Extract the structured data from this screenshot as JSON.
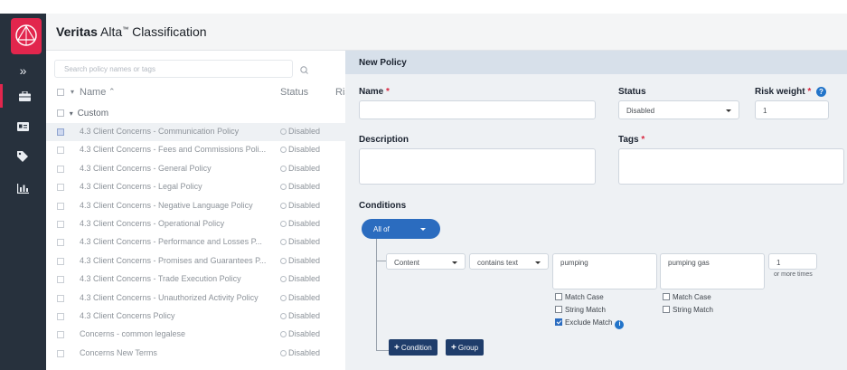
{
  "app": {
    "brand_bold": "Veritas",
    "brand_mid": " Alta",
    "brand_tm": "™",
    "brand_tail": " Classification"
  },
  "rail": {
    "expand_glyph": "»"
  },
  "search": {
    "placeholder": "Search policy names or tags"
  },
  "list": {
    "headers": {
      "name": "Name",
      "status": "Status",
      "risk": "Ris"
    },
    "group_label": "Custom",
    "rows": [
      {
        "name": "4.3 Client Concerns - Communication Policy",
        "status": "Disabled",
        "selected": true
      },
      {
        "name": "4.3 Client Concerns - Fees and Commissions Poli...",
        "status": "Disabled"
      },
      {
        "name": "4.3 Client Concerns - General Policy",
        "status": "Disabled"
      },
      {
        "name": "4.3 Client Concerns - Legal Policy",
        "status": "Disabled"
      },
      {
        "name": "4.3 Client Concerns - Negative Language Policy",
        "status": "Disabled"
      },
      {
        "name": "4.3 Client Concerns - Operational Policy",
        "status": "Disabled"
      },
      {
        "name": "4.3 Client Concerns - Performance and Losses P...",
        "status": "Disabled"
      },
      {
        "name": "4.3 Client Concerns - Promises and Guarantees P...",
        "status": "Disabled"
      },
      {
        "name": "4.3 Client Concerns - Trade Execution Policy",
        "status": "Disabled"
      },
      {
        "name": "4.3 Client Concerns - Unauthorized Activity Policy",
        "status": "Disabled"
      },
      {
        "name": "4.3 Client Concerns Policy",
        "status": "Disabled"
      },
      {
        "name": "Concerns - common legalese",
        "status": "Disabled"
      },
      {
        "name": "Concerns New Terms",
        "status": "Disabled"
      }
    ]
  },
  "form": {
    "title": "New Policy",
    "name_label": "Name",
    "status_label": "Status",
    "status_value": "Disabled",
    "risk_label": "Risk weight",
    "risk_value": "1",
    "description_label": "Description",
    "tags_label": "Tags",
    "required_mark": "*",
    "help_glyph": "?"
  },
  "conditions": {
    "label": "Conditions",
    "operator": "All of",
    "field": "Content",
    "op": "contains text",
    "value1": "pumping",
    "value2": "pumping gas",
    "count": "1",
    "count_suffix": "or more times",
    "match_case": "Match Case",
    "string_match": "String Match",
    "exclude_match": "Exclude Match",
    "info_glyph": "i",
    "add_condition": "Condition",
    "add_group": "Group",
    "plus_glyph": "+"
  }
}
